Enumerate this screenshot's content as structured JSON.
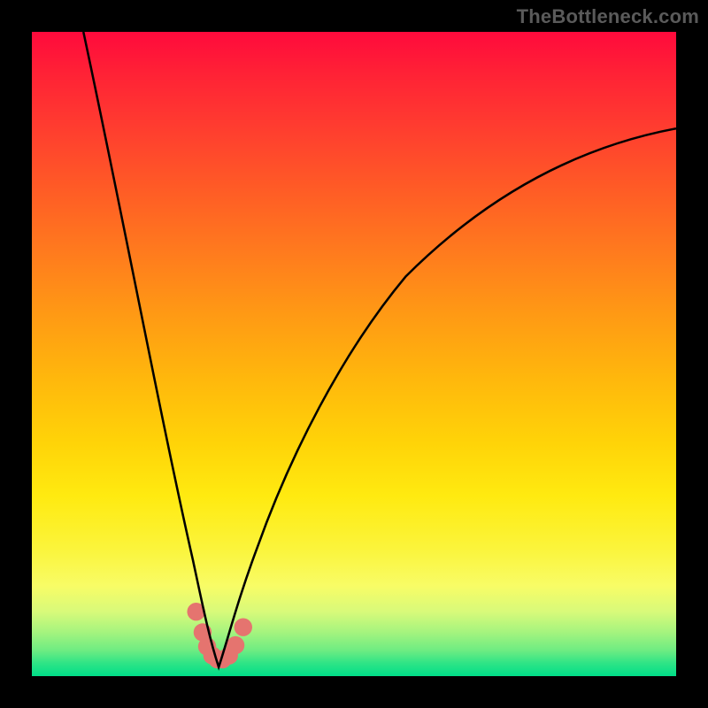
{
  "watermark": {
    "text": "TheBottleneck.com"
  },
  "colors": {
    "background": "#000000",
    "curve": "#000000",
    "markers": "#e5746f",
    "gradient_top": "#ff0a3c",
    "gradient_bottom": "#00de88"
  },
  "chart_data": {
    "type": "line",
    "title": "",
    "xlabel": "",
    "ylabel": "",
    "xlim": [
      0,
      100
    ],
    "ylim": [
      0,
      100
    ],
    "grid": false,
    "legend": false,
    "note": "V-shaped bottleneck curve; minimum near x≈29; values estimated from plot area since axes have no tick labels",
    "series": [
      {
        "name": "curve",
        "x": [
          8,
          10,
          12,
          14,
          16,
          18,
          20,
          22,
          24,
          25,
          26,
          27,
          28,
          29,
          30,
          31,
          32,
          33,
          35,
          38,
          42,
          46,
          50,
          55,
          60,
          66,
          72,
          80,
          88,
          96,
          100
        ],
        "y": [
          100,
          92,
          83,
          74,
          65,
          56,
          47,
          38,
          28,
          22,
          16,
          10,
          5,
          2,
          1,
          2,
          5,
          9,
          15,
          23,
          33,
          42,
          50,
          58,
          64,
          70,
          74,
          79,
          82,
          84,
          85
        ]
      }
    ],
    "markers": {
      "name": "near-minimum-points",
      "x": [
        25.5,
        26.5,
        27.2,
        28.0,
        28.8,
        29.6,
        30.6,
        31.6,
        32.8
      ],
      "y": [
        10.0,
        6.8,
        4.6,
        3.2,
        2.6,
        2.6,
        3.2,
        4.8,
        7.6
      ]
    }
  }
}
